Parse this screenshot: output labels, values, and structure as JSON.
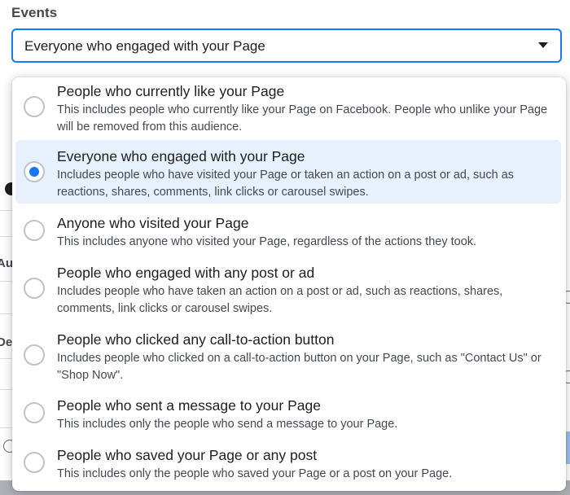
{
  "events": {
    "label": "Events",
    "selected_value": "Everyone who engaged with your Page"
  },
  "background": {
    "fragment_au": "Au",
    "fragment_de": "De"
  },
  "options": [
    {
      "title": "People who currently like your Page",
      "desc": "This includes people who currently like your Page on Facebook. People who unlike your Page will be removed from this audience.",
      "selected": false
    },
    {
      "title": "Everyone who engaged with your Page",
      "desc": "Includes people who have visited your Page or taken an action on a post or ad, such as reactions, shares, comments, link clicks or carousel swipes.",
      "selected": true
    },
    {
      "title": "Anyone who visited your Page",
      "desc": "This includes anyone who visited your Page, regardless of the actions they took.",
      "selected": false
    },
    {
      "title": "People who engaged with any post or ad",
      "desc": "Includes people who have taken an action on a post or ad, such as reactions, shares, comments, link clicks or carousel swipes.",
      "selected": false
    },
    {
      "title": "People who clicked any call-to-action button",
      "desc": "Includes people who clicked on a call-to-action button on your Page, such as \"Contact Us\" or \"Shop Now\".",
      "selected": false
    },
    {
      "title": "People who sent a message to your Page",
      "desc": "This includes only the people who send a message to your Page.",
      "selected": false
    },
    {
      "title": "People who saved your Page or any post",
      "desc": "This includes only the people who saved your Page or a post on your Page.",
      "selected": false
    }
  ],
  "colors": {
    "accent": "#1877f2",
    "selected_row": "#e7f0fd"
  }
}
